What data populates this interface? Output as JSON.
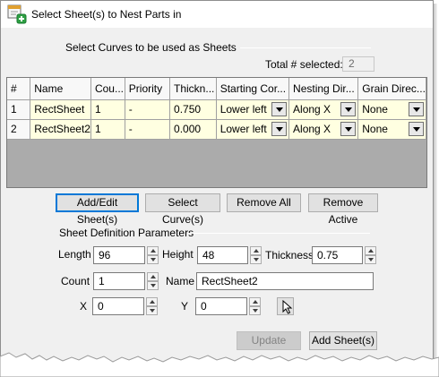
{
  "window": {
    "title": "Select Sheet(s) to Nest Parts in"
  },
  "curves_group": {
    "label": "Select Curves to be used as Sheets",
    "total_label": "Total # selected:",
    "total_value": "2"
  },
  "grid": {
    "columns": [
      "#",
      "Name",
      "Cou...",
      "Priority",
      "Thickn...",
      "Starting Cor...",
      "Nesting Dir...",
      "Grain Direc..."
    ],
    "rows": [
      {
        "num": "1",
        "name": "RectSheet",
        "count": "1",
        "priority": "-",
        "thickness": "0.750",
        "starting_corner": "Lower left",
        "nesting_dir": "Along X",
        "grain_dir": "None"
      },
      {
        "num": "2",
        "name": "RectSheet2",
        "count": "1",
        "priority": "-",
        "thickness": "0.000",
        "starting_corner": "Lower left",
        "nesting_dir": "Along X",
        "grain_dir": "None"
      }
    ]
  },
  "buttons": {
    "add_edit": "Add/Edit Sheet(s)",
    "select_curve": "Select Curve(s)",
    "remove_all": "Remove All",
    "remove_active": "Remove Active",
    "update": "Update",
    "add_sheet": "Add Sheet(s)"
  },
  "params": {
    "label": "Sheet Definition Parameters",
    "length_label": "Length",
    "length_value": "96",
    "height_label": "Height",
    "height_value": "48",
    "thickness_label": "Thickness",
    "thickness_value": "0.75",
    "count_label": "Count",
    "count_value": "1",
    "name_label": "Name",
    "name_value": "RectSheet2",
    "x_label": "X",
    "x_value": "0",
    "y_label": "Y",
    "y_value": "0"
  },
  "icons": [
    "app-sheet-icon",
    "dropdown-arrow-icon",
    "spin-up-icon",
    "spin-down-icon",
    "mouse-cursor-icon"
  ],
  "colors": {
    "row_fill": "#ffffe1",
    "grid_empty": "#ababab",
    "dialog_bg": "#f0f0f0",
    "focus_blue": "#0078d7"
  }
}
